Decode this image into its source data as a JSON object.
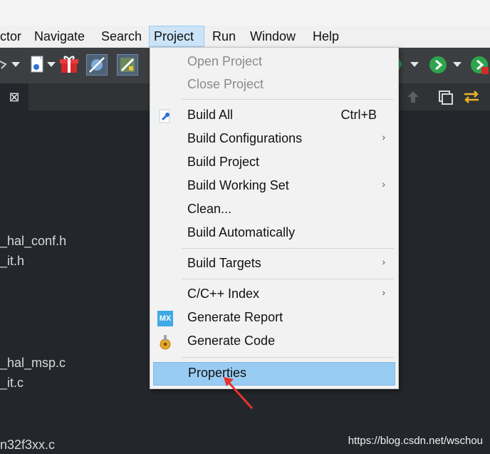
{
  "menubar": {
    "items": [
      "ctor",
      "Navigate",
      "Search",
      "Project",
      "Run",
      "Window",
      "Help"
    ]
  },
  "project_menu": {
    "open_project": "Open Project",
    "close_project": "Close Project",
    "build_all": "Build All",
    "build_all_shortcut": "Ctrl+B",
    "build_configurations": "Build Configurations",
    "build_project": "Build Project",
    "build_working_set": "Build Working Set",
    "clean": "Clean...",
    "build_automatically": "Build Automatically",
    "build_targets": "Build Targets",
    "cc_index": "C/C++ Index",
    "generate_report": "Generate Report",
    "generate_code": "Generate Code",
    "properties": "Properties",
    "mx_badge": "MX",
    "submenu_arrow": "›"
  },
  "tabrow": {
    "close_glyph": "⊠"
  },
  "files": [
    "_hal_conf.h",
    "_it.h",
    "_hal_msp.c",
    "_it.c",
    "n32f3xx.c"
  ],
  "watermark": "https://blog.csdn.net/wschou",
  "colors": {
    "highlight": "#99ccf3",
    "editor_bg": "#23272b",
    "pointer": "#e8322a"
  }
}
